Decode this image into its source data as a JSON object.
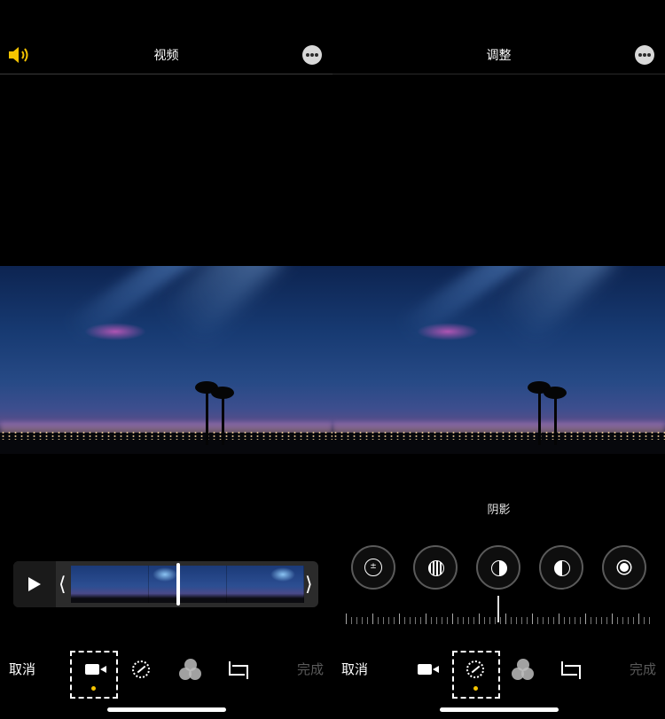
{
  "left_panel": {
    "title": "视频",
    "toolbar": {
      "cancel_label": "取消",
      "done_label": "完成",
      "active_tool": "video"
    }
  },
  "right_panel": {
    "title": "调整",
    "adjust_label": "阴影",
    "adjust_tools": [
      "exposure-icon",
      "brilliance-icon",
      "highlights-icon",
      "shadows-icon",
      "brightness-icon"
    ],
    "toolbar": {
      "cancel_label": "取消",
      "done_label": "完成",
      "active_tool": "adjust"
    }
  },
  "colors": {
    "accent_yellow": "#f5c400",
    "done_disabled": "#5a5a5a"
  }
}
